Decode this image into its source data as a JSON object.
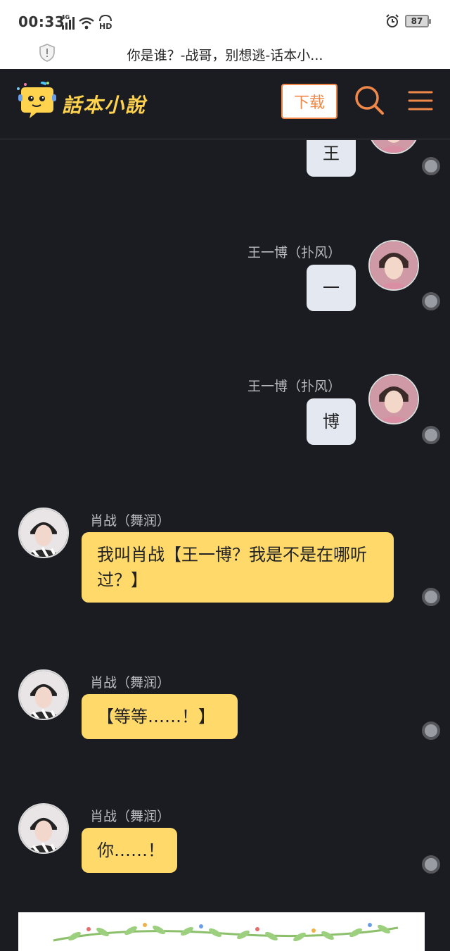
{
  "status": {
    "time": "00:33",
    "network": "4G",
    "battery": "87"
  },
  "browser": {
    "page_title": "你是谁？-战哥，别想逃-话本小..."
  },
  "header": {
    "logo_text": "話本小說",
    "download_label": "下载"
  },
  "chat": {
    "messages": [
      {
        "side": "right",
        "speaker": "",
        "text": "王"
      },
      {
        "side": "right",
        "speaker": "王一博（扑风）",
        "text": "一"
      },
      {
        "side": "right",
        "speaker": "王一博（扑风）",
        "text": "博"
      },
      {
        "side": "left",
        "speaker": "肖战（舞润）",
        "text": "我叫肖战【王一博？我是不是在哪听过？】"
      },
      {
        "side": "left",
        "speaker": "肖战（舞润）",
        "text": "【等等……！】"
      },
      {
        "side": "left",
        "speaker": "肖战（舞润）",
        "text": "你……！"
      }
    ]
  },
  "colors": {
    "background": "#1b1c21",
    "right_bubble": "#e4e9f1",
    "left_bubble": "#ffda6a",
    "accent": "#f0884a",
    "logo": "#ffd34e"
  },
  "icons": {
    "search": "search-icon",
    "menu": "menu-icon",
    "shield": "shield-icon"
  }
}
